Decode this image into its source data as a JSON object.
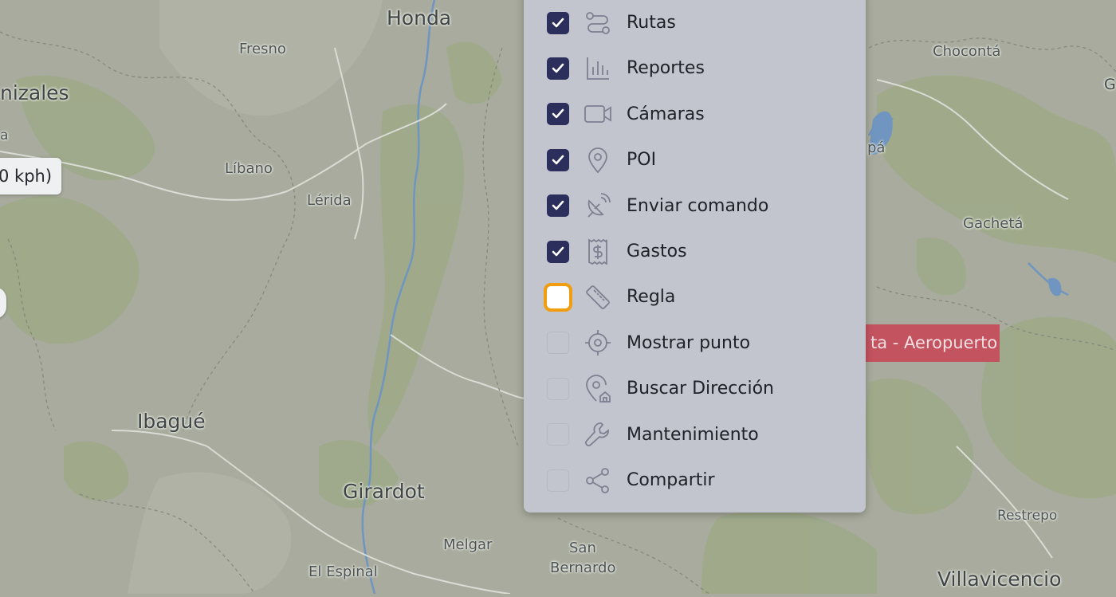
{
  "map": {
    "labels": {
      "honda": "Honda",
      "fresno": "Fresno",
      "manizales": "nizales",
      "libano": "Líbano",
      "lerida": "Lérida",
      "ibague": "Ibagué",
      "girardot": "Girardot",
      "melgar": "Melgar",
      "san": "San",
      "bernardo": "Bernardo",
      "el_espinal": "El Espinal",
      "choconta": "Chocontá",
      "gacheta": "Gachetá",
      "restrepo": "Restrepo",
      "villavicencio": "Villavicencio",
      "pa": "pá",
      "g": "G",
      "a": "a"
    },
    "speed_tag": "0 kph)",
    "geofence_tag": "ta - Aeropuerto"
  },
  "menu": {
    "items": [
      {
        "label": "Rutas",
        "icon": "route-icon",
        "state": "checked"
      },
      {
        "label": "Reportes",
        "icon": "bar-chart-icon",
        "state": "checked"
      },
      {
        "label": "Cámaras",
        "icon": "video-camera-icon",
        "state": "checked"
      },
      {
        "label": "POI",
        "icon": "map-pin-icon",
        "state": "checked"
      },
      {
        "label": "Enviar comando",
        "icon": "satellite-dish-icon",
        "state": "checked"
      },
      {
        "label": "Gastos",
        "icon": "receipt-dollar-icon",
        "state": "checked"
      },
      {
        "label": "Regla",
        "icon": "ruler-icon",
        "state": "focused-unchecked"
      },
      {
        "label": "Mostrar punto",
        "icon": "crosshair-icon",
        "state": "unchecked"
      },
      {
        "label": "Buscar Dirección",
        "icon": "location-home-icon",
        "state": "unchecked"
      },
      {
        "label": "Mantenimiento",
        "icon": "wrench-icon",
        "state": "unchecked"
      },
      {
        "label": "Compartir",
        "icon": "share-icon",
        "state": "unchecked"
      }
    ]
  },
  "colors": {
    "checkbox_checked": "#2c2e5b",
    "focus_ring": "#f09d0f",
    "panel_bg": "#c3c5ce",
    "geofence": "#c3535f"
  }
}
